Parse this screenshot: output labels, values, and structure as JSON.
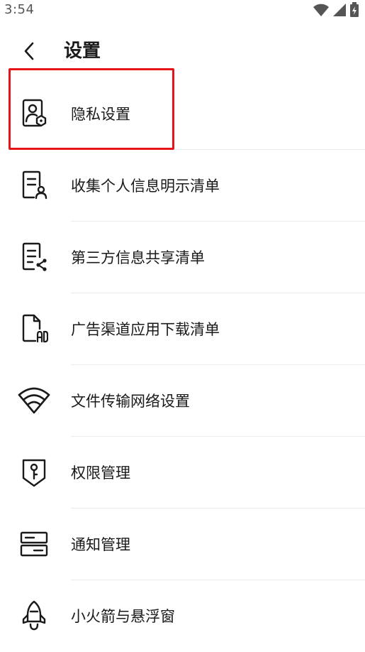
{
  "status_bar": {
    "time": "3:54",
    "icons": [
      "wifi-icon",
      "signal-icon",
      "battery-charging-icon"
    ]
  },
  "header": {
    "back_icon": "chevron-left-icon",
    "title": "设置"
  },
  "items": [
    {
      "icon": "privacy-settings-icon",
      "label": "隐私设置"
    },
    {
      "icon": "personal-info-list-icon",
      "label": "收集个人信息明示清单"
    },
    {
      "icon": "third-party-share-list-icon",
      "label": "第三方信息共享清单"
    },
    {
      "icon": "ad-channel-download-icon",
      "label": "广告渠道应用下载清单"
    },
    {
      "icon": "wifi-network-icon",
      "label": "文件传输网络设置"
    },
    {
      "icon": "permission-key-shield-icon",
      "label": "权限管理"
    },
    {
      "icon": "notification-management-icon",
      "label": "通知管理"
    },
    {
      "icon": "rocket-floating-window-icon",
      "label": "小火箭与悬浮窗"
    }
  ],
  "colors": {
    "highlight_border": "#e3141a",
    "text": "#1a1a1a",
    "divider": "#ebebeb"
  }
}
